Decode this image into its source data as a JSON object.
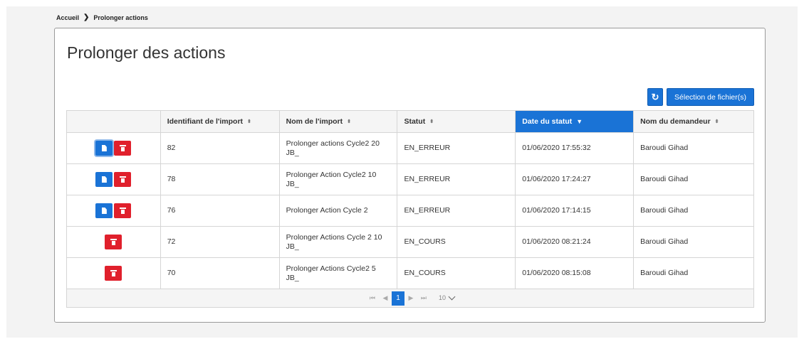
{
  "breadcrumb": {
    "home": "Accueil",
    "current": "Prolonger actions",
    "separator": "❯"
  },
  "page": {
    "title": "Prolonger des actions"
  },
  "toolbar": {
    "refresh_icon": "↻",
    "select_files_label": "Sélection de fichier(s)"
  },
  "table": {
    "headers": {
      "id": "Identifiant de l'import",
      "name": "Nom de l'import",
      "status": "Statut",
      "date": "Date du statut",
      "requester": "Nom du demandeur"
    },
    "sort_icon": "⬍",
    "sort_active_icon": "▼",
    "rows": [
      {
        "id": "82",
        "name": "Prolonger actions Cycle2 20 JB_",
        "status": "EN_ERREUR",
        "date": "01/06/2020 17:55:32",
        "requester": "Baroudi Gihad"
      },
      {
        "id": "78",
        "name": "Prolonger Action Cycle2 10 JB_",
        "status": "EN_ERREUR",
        "date": "01/06/2020 17:24:27",
        "requester": "Baroudi Gihad"
      },
      {
        "id": "76",
        "name": "Prolonger Action Cycle 2",
        "status": "EN_ERREUR",
        "date": "01/06/2020 17:14:15",
        "requester": "Baroudi Gihad"
      },
      {
        "id": "72",
        "name": "Prolonger Actions Cycle 2 10 JB_",
        "status": "EN_COURS",
        "date": "01/06/2020 08:21:24",
        "requester": "Baroudi Gihad"
      },
      {
        "id": "70",
        "name": "Prolonger Actions Cycle2 5 JB_",
        "status": "EN_COURS",
        "date": "01/06/2020 08:15:08",
        "requester": "Baroudi Gihad"
      }
    ]
  },
  "pagination": {
    "first": "⏮",
    "prev": "◀",
    "next": "▶",
    "last": "⏭",
    "current_page": "1",
    "page_size": "10"
  },
  "colors": {
    "accent": "#1a73d6",
    "danger": "#e0202c"
  }
}
